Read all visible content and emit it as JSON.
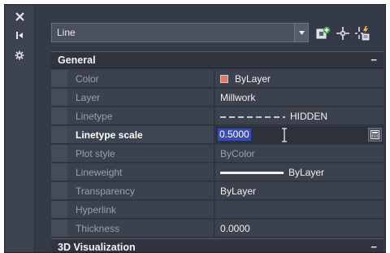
{
  "strip": {
    "buttons": [
      {
        "icon": "close-icon"
      },
      {
        "icon": "auto-hide-icon"
      },
      {
        "icon": "properties-icon"
      }
    ]
  },
  "selector": {
    "value": "Line",
    "icons": [
      "toggle-pickadd-icon",
      "select-objects-icon",
      "quick-select-icon"
    ]
  },
  "sections": [
    {
      "title": "General",
      "toggle": "−"
    },
    {
      "title": "3D Visualization",
      "toggle": "−"
    }
  ],
  "properties": [
    {
      "name": "Color",
      "value": "ByLayer",
      "swatch_color": "#e8795f"
    },
    {
      "name": "Layer",
      "value": "Millwork"
    },
    {
      "name": "Linetype",
      "value": "HIDDEN"
    },
    {
      "name": "Linetype scale",
      "value": "0.5000"
    },
    {
      "name": "Plot style",
      "value": "ByColor"
    },
    {
      "name": "Lineweight",
      "value": "ByLayer"
    },
    {
      "name": "Transparency",
      "value": "ByLayer"
    },
    {
      "name": "Hyperlink",
      "value": ""
    },
    {
      "name": "Thickness",
      "value": "0.0000"
    }
  ],
  "colors": {
    "background": "#343a47",
    "row": "#3b414d",
    "selection": "#3a4bb0",
    "dim_text": "#9aa0aa"
  }
}
